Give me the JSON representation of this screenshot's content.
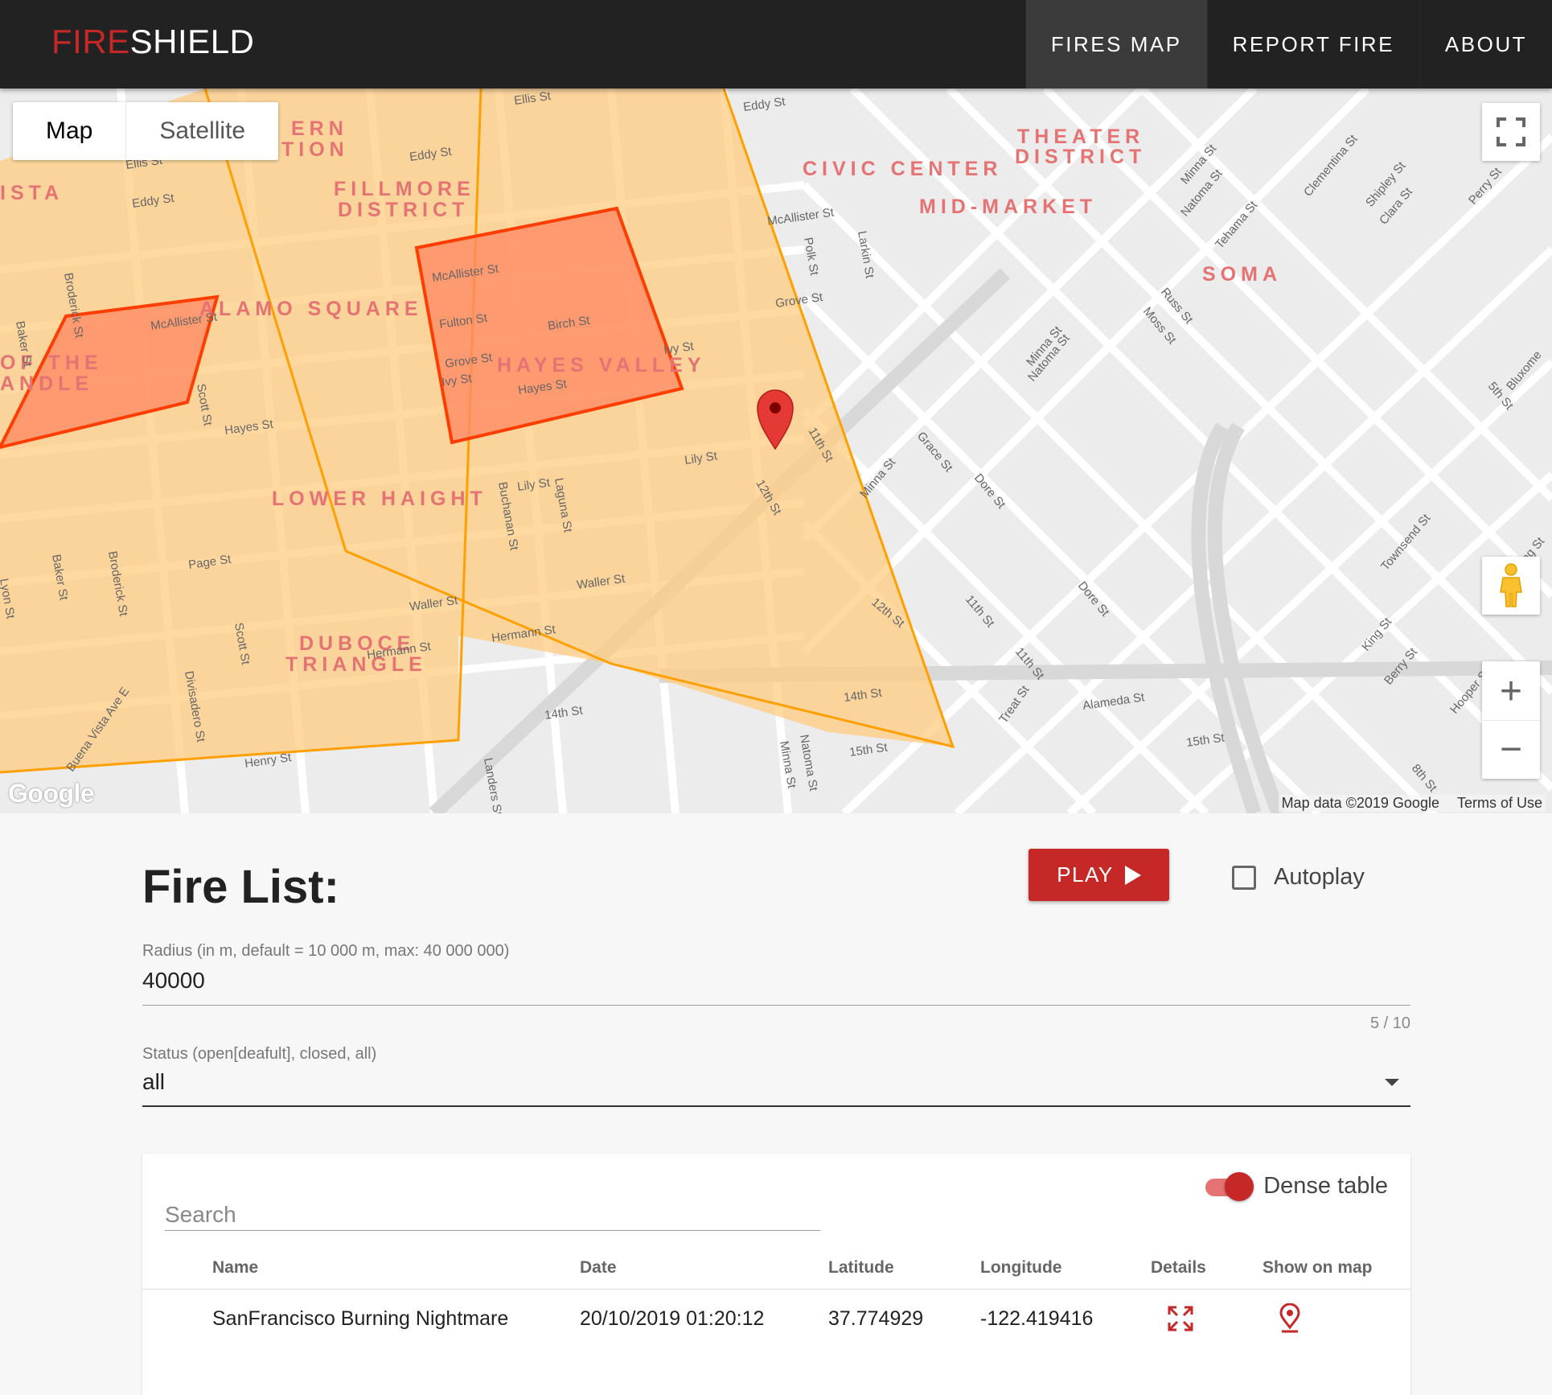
{
  "brand": {
    "part1": "FIRE",
    "part2": "SHIELD"
  },
  "nav": {
    "items": [
      {
        "label": "FIRES MAP",
        "active": true
      },
      {
        "label": "REPORT FIRE",
        "active": false
      },
      {
        "label": "ABOUT",
        "active": false
      }
    ]
  },
  "map": {
    "type_control": {
      "map": "Map",
      "satellite": "Satellite",
      "selected": "Map"
    },
    "zoom_in": "+",
    "zoom_out": "−",
    "logo": "Google",
    "attribution": {
      "data": "Map data ©2019 Google",
      "terms": "Terms of Use"
    },
    "colors": {
      "zone_fill": "#ffcc80",
      "zone_stroke": "#ffa000",
      "fire_fill": "#ff8a65",
      "fire_stroke": "#ff3d00",
      "marker": "#d32f2f"
    },
    "neighborhoods": [
      "ERN TION",
      "ISTA",
      "FILLMORE DISTRICT",
      "ALAMO SQUARE",
      "OF THE ANDLE",
      "HAYES VALLEY",
      "LOWER HAIGHT",
      "DUBOCE TRIANGLE",
      "CIVIC CENTER",
      "THEATER DISTRICT",
      "MID-MARKET",
      "SOMA"
    ],
    "streets": [
      "Ellis St",
      "Eddy St",
      "McAllister St",
      "Fulton St",
      "Grove St",
      "Ivy St",
      "Hayes St",
      "Birch St",
      "Lily St",
      "Page St",
      "Waller St",
      "Hermann St",
      "14th St",
      "15th St",
      "Henry St",
      "Polk St",
      "Larkin St",
      "11th St",
      "12th St",
      "Minna St",
      "Natoma St",
      "Tehama St",
      "Clementina St",
      "Russ St",
      "Moss St",
      "Grace St",
      "Dore St",
      "Townsend St",
      "King St",
      "Berry St",
      "Alameda St",
      "Treat St",
      "Buchanan St",
      "Laguna St",
      "Scott St",
      "Baker St",
      "Broderick St",
      "Divisadero St",
      "Lyon St",
      "Buena Vista Ave E",
      "Landers St",
      "Perry St",
      "Shipley St",
      "Clara St",
      "5th St",
      "Bluxome St",
      "Hooper St",
      "8th St"
    ]
  },
  "fire_list": {
    "title": "Fire List:",
    "play_label": "PLAY",
    "autoplay_label": "Autoplay",
    "autoplay_checked": false,
    "radius": {
      "label": "Radius (in m, default = 10 000 m, max: 40 000 000)",
      "value": "40000",
      "counter": "5 / 10"
    },
    "status": {
      "label": "Status (open[deafult], closed, all)",
      "value": "all"
    },
    "search_placeholder": "Search",
    "dense_label": "Dense table",
    "dense_on": true,
    "columns": [
      "Name",
      "Date",
      "Latitude",
      "Longitude",
      "Details",
      "Show on map"
    ],
    "rows": [
      {
        "name": "SanFrancisco Burning Nightmare",
        "date": "20/10/2019 01:20:12",
        "latitude": "37.774929",
        "longitude": "-122.419416"
      }
    ]
  }
}
